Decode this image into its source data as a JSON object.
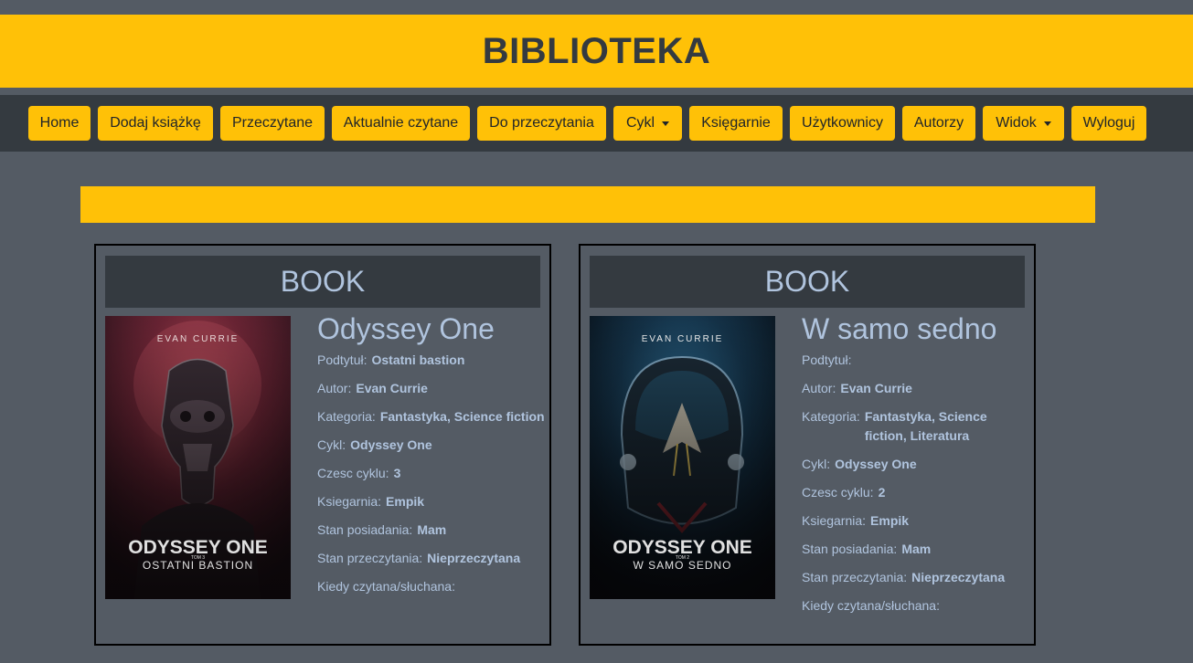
{
  "app": {
    "title": "BIBLIOTEKA"
  },
  "nav": {
    "items": [
      {
        "label": "Home",
        "dropdown": false
      },
      {
        "label": "Dodaj książkę",
        "dropdown": false
      },
      {
        "label": "Przeczytane",
        "dropdown": false
      },
      {
        "label": "Aktualnie czytane",
        "dropdown": false
      },
      {
        "label": "Do przeczytania",
        "dropdown": false
      },
      {
        "label": "Cykl",
        "dropdown": true
      },
      {
        "label": "Księgarnie",
        "dropdown": false
      },
      {
        "label": "Użytkownicy",
        "dropdown": false
      },
      {
        "label": "Autorzy",
        "dropdown": false
      },
      {
        "label": "Widok",
        "dropdown": true
      },
      {
        "label": "Wyloguj",
        "dropdown": false
      }
    ]
  },
  "colors": {
    "accent": "#ffc107",
    "background": "#545b64",
    "dark": "#343a40",
    "text_light": "#b0c4de"
  },
  "books": [
    {
      "header": "BOOK",
      "title": "Odyssey One",
      "cover": {
        "author": "EVAN CURRIE",
        "series": "ODYSSEY ONE",
        "volume": "TOM 3",
        "subtitle": "OSTATNI BASTION"
      },
      "fields": [
        {
          "label": "Podtytuł:",
          "value": "Ostatni bastion"
        },
        {
          "label": "Autor:",
          "value": "Evan Currie"
        },
        {
          "label": "Kategoria:",
          "value": "Fantastyka, Science fiction"
        },
        {
          "label": "Cykl:",
          "value": "Odyssey One"
        },
        {
          "label": "Czesc cyklu:",
          "value": "3"
        },
        {
          "label": "Ksiegarnia:",
          "value": "Empik"
        },
        {
          "label": "Stan posiadania:",
          "value": "Mam"
        },
        {
          "label": "Stan przeczytania:",
          "value": "Nieprzeczytana"
        },
        {
          "label": "Kiedy czytana/słuchana:",
          "value": ""
        }
      ]
    },
    {
      "header": "BOOK",
      "title": "W samo sedno",
      "cover": {
        "author": "EVAN CURRIE",
        "series": "ODYSSEY ONE",
        "volume": "TOM 2",
        "subtitle": "W SAMO SEDNO"
      },
      "fields": [
        {
          "label": "Podtytuł:",
          "value": ""
        },
        {
          "label": "Autor:",
          "value": "Evan Currie"
        },
        {
          "label": "Kategoria:",
          "value": "Fantastyka, Science fiction, Literatura"
        },
        {
          "label": "Cykl:",
          "value": "Odyssey One"
        },
        {
          "label": "Czesc cyklu:",
          "value": "2"
        },
        {
          "label": "Ksiegarnia:",
          "value": "Empik"
        },
        {
          "label": "Stan posiadania:",
          "value": "Mam"
        },
        {
          "label": "Stan przeczytania:",
          "value": "Nieprzeczytana"
        },
        {
          "label": "Kiedy czytana/słuchana:",
          "value": ""
        }
      ]
    }
  ]
}
